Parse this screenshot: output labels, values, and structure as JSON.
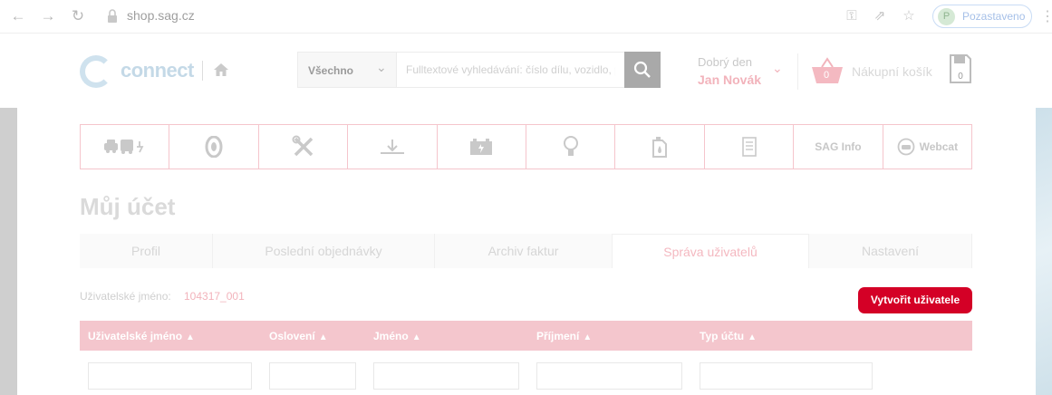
{
  "browser": {
    "url": "shop.sag.cz",
    "profile_initial": "P",
    "profile_label": "Pozastaveno"
  },
  "header": {
    "logo_text": "connect",
    "search": {
      "category": "Všechno",
      "placeholder": "Fulltextové vyhledávání: číslo dílu, vozidlo, popis",
      "value": ""
    },
    "greeting": "Dobrý den",
    "user_name": "Jan Novák",
    "cart_count": "0",
    "cart_label": "Nákupní košík",
    "saved_count": "0"
  },
  "categories": [
    {
      "icon": "vehicles-icon",
      "label": ""
    },
    {
      "icon": "tire-icon",
      "label": ""
    },
    {
      "icon": "tools-icon",
      "label": ""
    },
    {
      "icon": "download-icon",
      "label": ""
    },
    {
      "icon": "battery-icon",
      "label": ""
    },
    {
      "icon": "bulb-icon",
      "label": ""
    },
    {
      "icon": "oil-can-icon",
      "label": ""
    },
    {
      "icon": "document-icon",
      "label": ""
    },
    {
      "icon": "",
      "label": "SAG Info"
    },
    {
      "icon": "webcat-icon",
      "label": "Webcat"
    }
  ],
  "page": {
    "title": "Můj účet",
    "tabs": [
      {
        "label": "Profil",
        "active": false
      },
      {
        "label": "Poslední objednávky",
        "active": false
      },
      {
        "label": "Archiv faktur",
        "active": false
      },
      {
        "label": "Správa uživatelů",
        "active": true
      },
      {
        "label": "Nastavení",
        "active": false
      }
    ],
    "username_label": "Uživatelské jméno:",
    "username_value": "104317_001",
    "create_user_label": "Vytvořit uživatele"
  },
  "table": {
    "columns": [
      "Uživatelské jméno",
      "Oslovení",
      "Jméno",
      "Příjmení",
      "Typ účtu"
    ],
    "filters": [
      "",
      "",
      "",
      "",
      ""
    ]
  },
  "colors": {
    "accent": "#d40026",
    "accent_light": "#f4c6cd",
    "border_pink": "#f5c5cc"
  }
}
